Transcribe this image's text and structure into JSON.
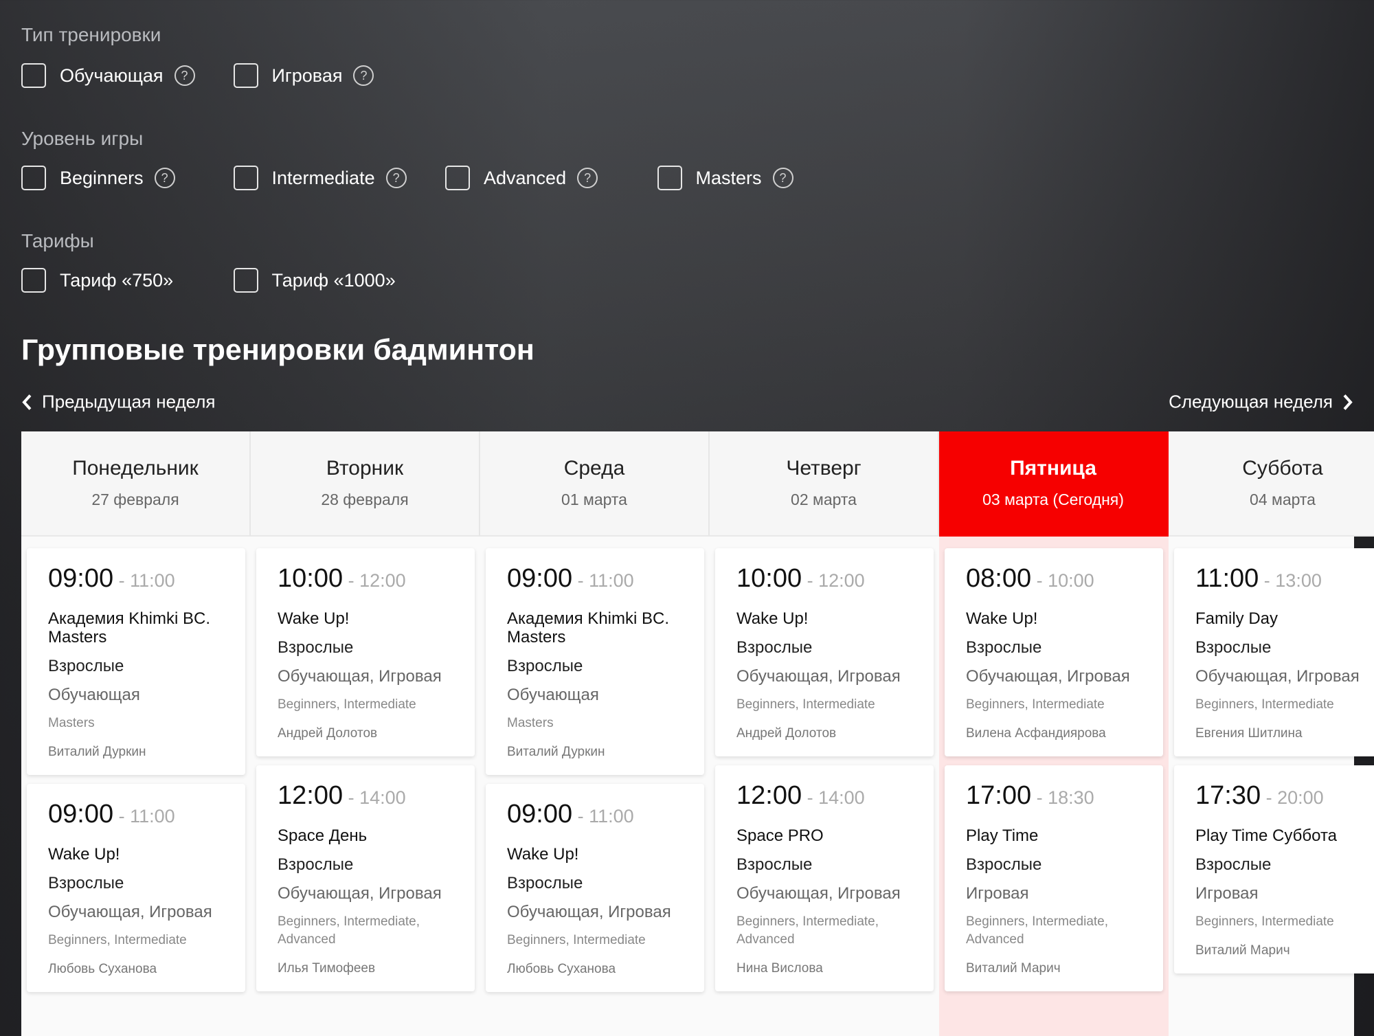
{
  "filters": {
    "type": {
      "label": "Тип тренировки",
      "options": [
        {
          "label": "Обучающая",
          "checked": false
        },
        {
          "label": "Игровая",
          "checked": false
        }
      ]
    },
    "level": {
      "label": "Уровень игры",
      "options": [
        {
          "label": "Beginners",
          "checked": false
        },
        {
          "label": "Intermediate",
          "checked": false
        },
        {
          "label": "Advanced",
          "checked": false
        },
        {
          "label": "Masters",
          "checked": false
        }
      ]
    },
    "tariff": {
      "label": "Тарифы",
      "options": [
        {
          "label": "Тариф «750»",
          "checked": false
        },
        {
          "label": "Тариф «1000»",
          "checked": false
        }
      ]
    },
    "help_glyph": "?"
  },
  "title": "Групповые тренировки бадминтон",
  "nav": {
    "prev": "Предыдущая неделя",
    "next": "Следующая неделя"
  },
  "accent": "#f60000",
  "days": [
    {
      "name": "Понедельник",
      "date": "27 февраля",
      "today": false,
      "sessions": [
        {
          "start": "09:00",
          "end": "11:00",
          "name": "Академия Khimki BC. Masters",
          "age": "Взрослые",
          "type": "Обучающая",
          "levels": "Masters",
          "coach": "Виталий Дуркин"
        },
        {
          "start": "09:00",
          "end": "11:00",
          "name": "Wake Up!",
          "age": "Взрослые",
          "type": "Обучающая, Игровая",
          "levels": "Beginners, Intermediate",
          "coach": "Любовь Суханова"
        }
      ]
    },
    {
      "name": "Вторник",
      "date": "28 февраля",
      "today": false,
      "sessions": [
        {
          "start": "10:00",
          "end": "12:00",
          "name": "Wake Up!",
          "age": "Взрослые",
          "type": "Обучающая, Игровая",
          "levels": "Beginners, Intermediate",
          "coach": "Андрей Долотов"
        },
        {
          "start": "12:00",
          "end": "14:00",
          "name": "Space День",
          "age": "Взрослые",
          "type": "Обучающая, Игровая",
          "levels": "Beginners, Intermediate, Advanced",
          "coach": "Илья Тимофеев"
        }
      ]
    },
    {
      "name": "Среда",
      "date": "01 марта",
      "today": false,
      "sessions": [
        {
          "start": "09:00",
          "end": "11:00",
          "name": "Академия Khimki BC. Masters",
          "age": "Взрослые",
          "type": "Обучающая",
          "levels": "Masters",
          "coach": "Виталий Дуркин"
        },
        {
          "start": "09:00",
          "end": "11:00",
          "name": "Wake Up!",
          "age": "Взрослые",
          "type": "Обучающая, Игровая",
          "levels": "Beginners, Intermediate",
          "coach": "Любовь Суханова"
        }
      ]
    },
    {
      "name": "Четверг",
      "date": "02 марта",
      "today": false,
      "sessions": [
        {
          "start": "10:00",
          "end": "12:00",
          "name": "Wake Up!",
          "age": "Взрослые",
          "type": "Обучающая, Игровая",
          "levels": "Beginners, Intermediate",
          "coach": "Андрей Долотов"
        },
        {
          "start": "12:00",
          "end": "14:00",
          "name": "Space PRO",
          "age": "Взрослые",
          "type": "Обучающая, Игровая",
          "levels": "Beginners, Intermediate, Advanced",
          "coach": "Нина Вислова"
        }
      ]
    },
    {
      "name": "Пятница",
      "date": "03 марта (Сегодня)",
      "today": true,
      "sessions": [
        {
          "start": "08:00",
          "end": "10:00",
          "name": "Wake Up!",
          "age": "Взрослые",
          "type": "Обучающая, Игровая",
          "levels": "Beginners, Intermediate",
          "coach": "Вилена Асфандиярова"
        },
        {
          "start": "17:00",
          "end": "18:30",
          "name": "Play Time",
          "age": "Взрослые",
          "type": "Игровая",
          "levels": "Beginners, Intermediate, Advanced",
          "coach": "Виталий Марич"
        }
      ]
    },
    {
      "name": "Суббота",
      "date": "04 марта",
      "today": false,
      "sessions": [
        {
          "start": "11:00",
          "end": "13:00",
          "name": "Family Day",
          "age": "Взрослые",
          "type": "Обучающая, Игровая",
          "levels": "Beginners, Intermediate",
          "coach": "Евгения Шитлина"
        },
        {
          "start": "17:30",
          "end": "20:00",
          "name": "Play Time Суббота",
          "age": "Взрослые",
          "type": "Игровая",
          "levels": "Beginners, Intermediate",
          "coach": "Виталий Марич"
        }
      ]
    }
  ]
}
